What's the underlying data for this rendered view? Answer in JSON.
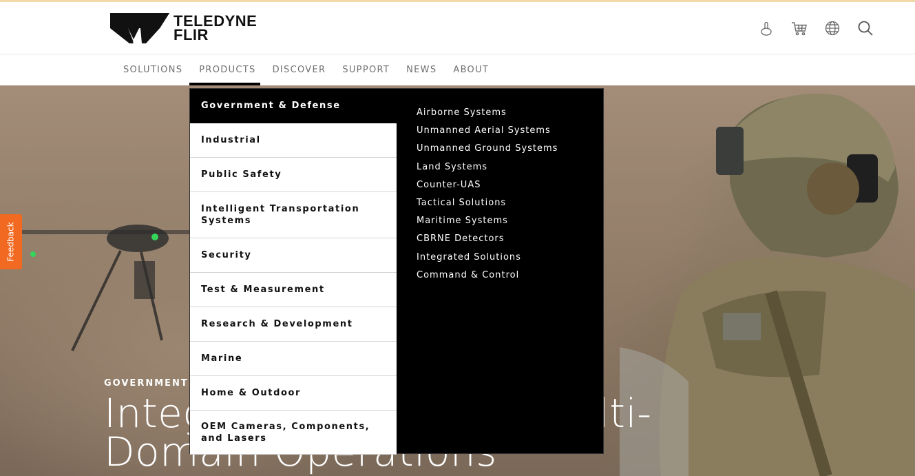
{
  "brand": {
    "line1": "TELEDYNE",
    "line2": "FLIR"
  },
  "header_icons": [
    {
      "name": "user-account-icon"
    },
    {
      "name": "cart-icon"
    },
    {
      "name": "globe-icon"
    },
    {
      "name": "search-icon"
    }
  ],
  "nav": {
    "items": [
      {
        "label": "SOLUTIONS"
      },
      {
        "label": "PRODUCTS"
      },
      {
        "label": "DISCOVER"
      },
      {
        "label": "SUPPORT"
      },
      {
        "label": "NEWS"
      },
      {
        "label": "ABOUT"
      }
    ],
    "active": "PRODUCTS"
  },
  "mega_menu": {
    "categories": [
      {
        "label": "Government & Defense",
        "active": true
      },
      {
        "label": "Industrial"
      },
      {
        "label": "Public Safety"
      },
      {
        "label": "Intelligent Transportation Systems"
      },
      {
        "label": "Security"
      },
      {
        "label": "Test & Measurement"
      },
      {
        "label": "Research & Development"
      },
      {
        "label": "Marine"
      },
      {
        "label": "Home & Outdoor"
      },
      {
        "label": "OEM Cameras, Components, and Lasers"
      }
    ],
    "sublinks": [
      {
        "label": "Airborne Systems"
      },
      {
        "label": "Unmanned Aerial Systems"
      },
      {
        "label": "Unmanned Ground Systems"
      },
      {
        "label": "Land Systems"
      },
      {
        "label": "Counter-UAS"
      },
      {
        "label": "Tactical Solutions"
      },
      {
        "label": "Maritime Systems"
      },
      {
        "label": "CBRNE Detectors"
      },
      {
        "label": "Integrated Solutions"
      },
      {
        "label": "Command & Control"
      }
    ]
  },
  "hero": {
    "eyebrow": "GOVERNMENT &",
    "title_line1": "Integ                              lti-",
    "title_line2": "Domain Operations"
  },
  "feedback": {
    "label": "Feedback"
  },
  "colors": {
    "accent": "#f26a21",
    "menu_bg": "#000000",
    "nav_text": "#707070"
  }
}
